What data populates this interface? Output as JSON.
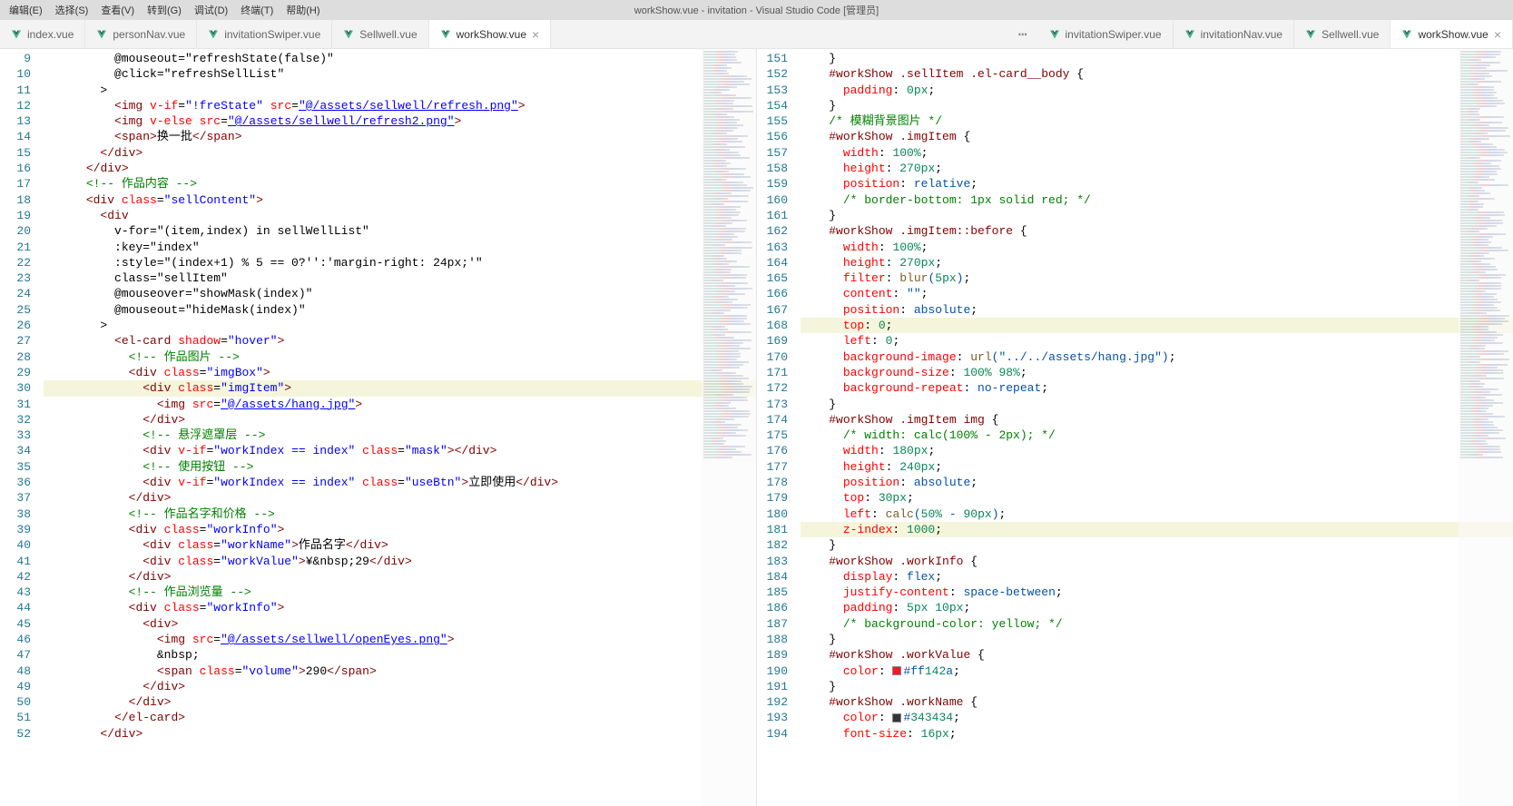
{
  "title": "workShow.vue - invitation - Visual Studio Code [管理员]",
  "menu": [
    "编辑(E)",
    "选择(S)",
    "查看(V)",
    "转到(G)",
    "调试(D)",
    "终端(T)",
    "帮助(H)"
  ],
  "tabs_left": [
    {
      "label": "index.vue",
      "active": false,
      "close": false
    },
    {
      "label": "personNav.vue",
      "active": false,
      "close": false
    },
    {
      "label": "invitationSwiper.vue",
      "active": false,
      "close": false
    },
    {
      "label": "Sellwell.vue",
      "active": false,
      "close": false
    },
    {
      "label": "workShow.vue",
      "active": true,
      "close": true
    }
  ],
  "tabs_right": [
    {
      "label": "invitationSwiper.vue",
      "active": false,
      "close": false
    },
    {
      "label": "invitationNav.vue",
      "active": false,
      "close": false
    },
    {
      "label": "Sellwell.vue",
      "active": false,
      "close": false
    },
    {
      "label": "workShow.vue",
      "active": true,
      "close": true
    }
  ],
  "left_start": 9,
  "left_lines": [
    "          @mouseout=\"refreshState(false)\"",
    "          @click=\"refreshSellList\"",
    "        >",
    "          <img v-if=\"!freState\" src=\"@/assets/sellwell/refresh.png\">",
    "          <img v-else src=\"@/assets/sellwell/refresh2.png\">",
    "          <span>换一批</span>",
    "        </div>",
    "      </div>",
    "      <!-- 作品内容 -->",
    "      <div class=\"sellContent\">",
    "        <div",
    "          v-for=\"(item,index) in sellWellList\"",
    "          :key=\"index\"",
    "          :style=\"(index+1) % 5 == 0?'':'margin-right: 24px;'\"",
    "          class=\"sellItem\"",
    "          @mouseover=\"showMask(index)\"",
    "          @mouseout=\"hideMask(index)\"",
    "        >",
    "          <el-card shadow=\"hover\">",
    "            <!-- 作品图片 -->",
    "            <div class=\"imgBox\">",
    "              <div class=\"imgItem\">",
    "                <img src=\"@/assets/hang.jpg\">",
    "              </div>",
    "              <!-- 悬浮遮罩层 -->",
    "              <div v-if=\"workIndex == index\" class=\"mask\"></div>",
    "              <!-- 使用按钮 -->",
    "              <div v-if=\"workIndex == index\" class=\"useBtn\">立即使用</div>",
    "            </div>",
    "            <!-- 作品名字和价格 -->",
    "            <div class=\"workInfo\">",
    "              <div class=\"workName\">作品名字</div>",
    "              <div class=\"workValue\">¥&nbsp;29</div>",
    "            </div>",
    "            <!-- 作品浏览量 -->",
    "            <div class=\"workInfo\">",
    "              <div>",
    "                <img src=\"@/assets/sellwell/openEyes.png\">",
    "                &nbsp;",
    "                <span class=\"volume\">290</span>",
    "              </div>",
    "            </div>",
    "          </el-card>",
    "        </div>"
  ],
  "right_start": 151,
  "right_lines": [
    "    }",
    "    #workShow .sellItem .el-card__body {",
    "      padding: 0px;",
    "    }",
    "    /* 模糊背景图片 */",
    "    #workShow .imgItem {",
    "      width: 100%;",
    "      height: 270px;",
    "      position: relative;",
    "      /* border-bottom: 1px solid red; */",
    "    }",
    "    #workShow .imgItem::before {",
    "      width: 100%;",
    "      height: 270px;",
    "      filter: blur(5px);",
    "      content: \"\";",
    "      position: absolute;",
    "      top: 0;",
    "      left: 0;",
    "      background-image: url(\"../../assets/hang.jpg\");",
    "      background-size: 100% 98%;",
    "      background-repeat: no-repeat;",
    "    }",
    "    #workShow .imgItem img {",
    "      /* width: calc(100% - 2px); */",
    "      width: 180px;",
    "      height: 240px;",
    "      position: absolute;",
    "      top: 30px;",
    "      left: calc(50% - 90px);",
    "      z-index: 1000;",
    "    }",
    "    #workShow .workInfo {",
    "      display: flex;",
    "      justify-content: space-between;",
    "      padding: 5px 10px;",
    "      /* background-color: yellow; */",
    "    }",
    "    #workShow .workValue {",
    "      color: #ff142a;",
    "    }",
    "    #workShow .workName {",
    "      color: #343434;",
    "      font-size: 16px;"
  ],
  "colors": {
    "ff142a": "#ff142a",
    "343434": "#343434"
  }
}
